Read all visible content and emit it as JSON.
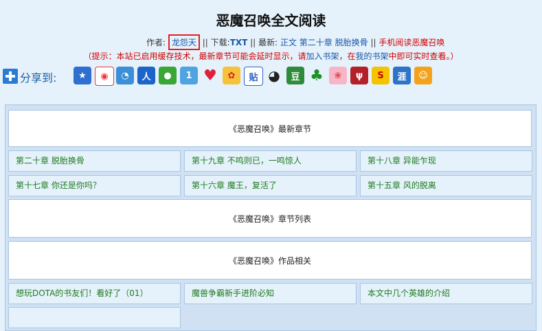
{
  "page": {
    "title": "恶魔召唤全文阅读"
  },
  "info": {
    "author_label": "作者:",
    "author": "龙怨天",
    "sep": "||",
    "download_label": "下载:",
    "download_link": "TXT",
    "latest_label": "最新:",
    "latest_prefix": "正文",
    "latest_chapter": "第二十章 脱胎换骨",
    "mobile_link": "手机阅读恶魔召唤"
  },
  "notice": {
    "part1": "（提示：本站已启用缓存技术，最新章节可能会延时显示，请",
    "link1": "加入书架",
    "part2": "，在",
    "link2": "我的书架",
    "part3": "中即可实时查看。）"
  },
  "share": {
    "label": "分享到:",
    "icons": [
      "qzone-icon",
      "weibo-icon",
      "tencent-weibo-icon",
      "renren-icon",
      "wechat-icon",
      "kaixin-icon",
      "heart-icon",
      "flower-icon",
      "tieba-icon",
      "qq-icon",
      "douban-icon",
      "clover-icon",
      "pink-icon",
      "tianya-icon",
      "sohu-icon",
      "zhihu-icon",
      "smile-icon"
    ]
  },
  "sections": {
    "latest": "《恶魔召唤》最新章节",
    "list": "《恶魔召唤》章节列表",
    "related": "《恶魔召唤》作品相关"
  },
  "latest_chapters": [
    "第二十章 脱胎换骨",
    "第十九章 不鸣则已，一鸣惊人",
    "第十八章 异能乍现",
    "第十七章 你还是你吗？",
    "第十六章 魔王，复活了",
    "第十五章 风的脱离"
  ],
  "related_items": [
    "想玩DOTA的书友们！看好了（01）",
    "魔兽争霸新手进阶必知",
    "本文中几个英雄的介绍",
    ""
  ],
  "colors": {
    "link": "#1a55a8",
    "chapter": "#1f7a1f",
    "notice": "#d00000",
    "highlight_box": "#e02020"
  }
}
